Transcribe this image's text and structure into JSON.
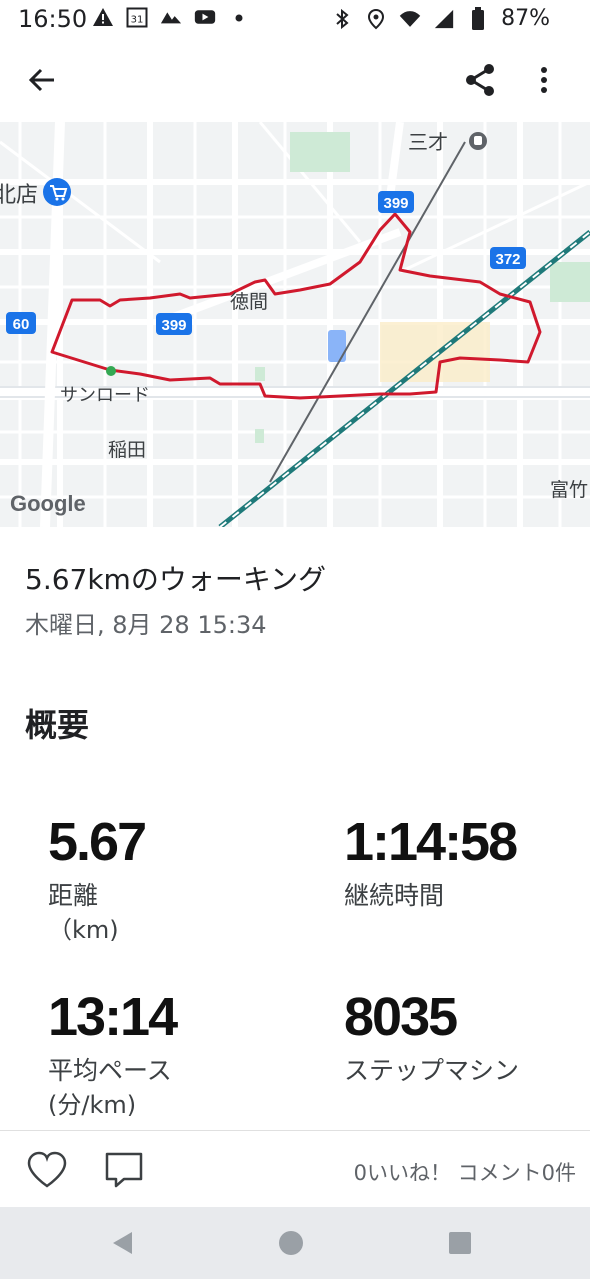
{
  "status_bar": {
    "time": "16:50",
    "left_icons": [
      "warning-icon",
      "calendar-31-icon",
      "maps-icon",
      "youtube-icon",
      "dot-icon"
    ],
    "calendar_day": "31",
    "right_icons": [
      "bluetooth-icon",
      "location-icon",
      "wifi-icon",
      "signal-icon",
      "battery-icon"
    ],
    "battery": "87%"
  },
  "app_bar": {
    "back_icon": "arrow-left-icon",
    "share_icon": "share-icon",
    "more_icon": "more-vert-icon"
  },
  "map": {
    "labels": {
      "station": "三才",
      "shop": "北店",
      "route_399_top": "399",
      "route_372": "372",
      "place_tokuma": "徳間",
      "route_399_left": "399",
      "route_60": "60",
      "place_sunroad": "サンロード",
      "place_inada": "稲田",
      "place_tomi": "富竹",
      "google": "Google"
    },
    "route_color": "#d0192d",
    "start_marker_color": "#34a853"
  },
  "activity": {
    "title": "5.67kmのウォーキング",
    "date": "木曜日, 8月 28 15:34"
  },
  "summary": {
    "heading": "概要",
    "stats": [
      {
        "value": "5.67",
        "label": "距離",
        "unit": "（km)"
      },
      {
        "value": "1:14:58",
        "label": "継続時間",
        "unit": ""
      },
      {
        "value": "13:14",
        "label": "平均ペース",
        "unit": "(分/km)"
      },
      {
        "value": "8035",
        "label": "ステップマシン",
        "unit": ""
      }
    ]
  },
  "footer": {
    "like_icon": "heart-outline-icon",
    "comment_icon": "comment-outline-icon",
    "counts": "0いいね！ コメント0件"
  },
  "nav_bar": {
    "back": "nav-back-icon",
    "home": "nav-home-icon",
    "recents": "nav-recents-icon"
  }
}
